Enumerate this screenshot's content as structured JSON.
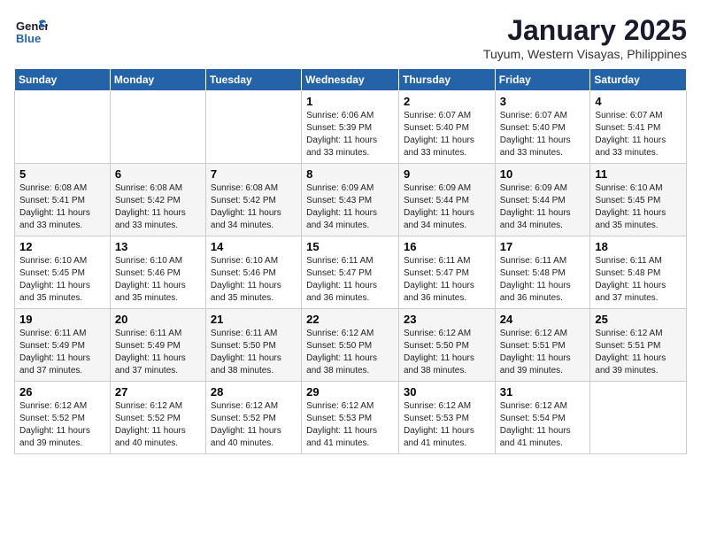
{
  "logo": {
    "line1": "General",
    "line2": "Blue"
  },
  "header": {
    "month": "January 2025",
    "location": "Tuyum, Western Visayas, Philippines"
  },
  "weekdays": [
    "Sunday",
    "Monday",
    "Tuesday",
    "Wednesday",
    "Thursday",
    "Friday",
    "Saturday"
  ],
  "weeks": [
    [
      {
        "day": "",
        "sunrise": "",
        "sunset": "",
        "daylight": ""
      },
      {
        "day": "",
        "sunrise": "",
        "sunset": "",
        "daylight": ""
      },
      {
        "day": "",
        "sunrise": "",
        "sunset": "",
        "daylight": ""
      },
      {
        "day": "1",
        "sunrise": "Sunrise: 6:06 AM",
        "sunset": "Sunset: 5:39 PM",
        "daylight": "Daylight: 11 hours and 33 minutes."
      },
      {
        "day": "2",
        "sunrise": "Sunrise: 6:07 AM",
        "sunset": "Sunset: 5:40 PM",
        "daylight": "Daylight: 11 hours and 33 minutes."
      },
      {
        "day": "3",
        "sunrise": "Sunrise: 6:07 AM",
        "sunset": "Sunset: 5:40 PM",
        "daylight": "Daylight: 11 hours and 33 minutes."
      },
      {
        "day": "4",
        "sunrise": "Sunrise: 6:07 AM",
        "sunset": "Sunset: 5:41 PM",
        "daylight": "Daylight: 11 hours and 33 minutes."
      }
    ],
    [
      {
        "day": "5",
        "sunrise": "Sunrise: 6:08 AM",
        "sunset": "Sunset: 5:41 PM",
        "daylight": "Daylight: 11 hours and 33 minutes."
      },
      {
        "day": "6",
        "sunrise": "Sunrise: 6:08 AM",
        "sunset": "Sunset: 5:42 PM",
        "daylight": "Daylight: 11 hours and 33 minutes."
      },
      {
        "day": "7",
        "sunrise": "Sunrise: 6:08 AM",
        "sunset": "Sunset: 5:42 PM",
        "daylight": "Daylight: 11 hours and 34 minutes."
      },
      {
        "day": "8",
        "sunrise": "Sunrise: 6:09 AM",
        "sunset": "Sunset: 5:43 PM",
        "daylight": "Daylight: 11 hours and 34 minutes."
      },
      {
        "day": "9",
        "sunrise": "Sunrise: 6:09 AM",
        "sunset": "Sunset: 5:44 PM",
        "daylight": "Daylight: 11 hours and 34 minutes."
      },
      {
        "day": "10",
        "sunrise": "Sunrise: 6:09 AM",
        "sunset": "Sunset: 5:44 PM",
        "daylight": "Daylight: 11 hours and 34 minutes."
      },
      {
        "day": "11",
        "sunrise": "Sunrise: 6:10 AM",
        "sunset": "Sunset: 5:45 PM",
        "daylight": "Daylight: 11 hours and 35 minutes."
      }
    ],
    [
      {
        "day": "12",
        "sunrise": "Sunrise: 6:10 AM",
        "sunset": "Sunset: 5:45 PM",
        "daylight": "Daylight: 11 hours and 35 minutes."
      },
      {
        "day": "13",
        "sunrise": "Sunrise: 6:10 AM",
        "sunset": "Sunset: 5:46 PM",
        "daylight": "Daylight: 11 hours and 35 minutes."
      },
      {
        "day": "14",
        "sunrise": "Sunrise: 6:10 AM",
        "sunset": "Sunset: 5:46 PM",
        "daylight": "Daylight: 11 hours and 35 minutes."
      },
      {
        "day": "15",
        "sunrise": "Sunrise: 6:11 AM",
        "sunset": "Sunset: 5:47 PM",
        "daylight": "Daylight: 11 hours and 36 minutes."
      },
      {
        "day": "16",
        "sunrise": "Sunrise: 6:11 AM",
        "sunset": "Sunset: 5:47 PM",
        "daylight": "Daylight: 11 hours and 36 minutes."
      },
      {
        "day": "17",
        "sunrise": "Sunrise: 6:11 AM",
        "sunset": "Sunset: 5:48 PM",
        "daylight": "Daylight: 11 hours and 36 minutes."
      },
      {
        "day": "18",
        "sunrise": "Sunrise: 6:11 AM",
        "sunset": "Sunset: 5:48 PM",
        "daylight": "Daylight: 11 hours and 37 minutes."
      }
    ],
    [
      {
        "day": "19",
        "sunrise": "Sunrise: 6:11 AM",
        "sunset": "Sunset: 5:49 PM",
        "daylight": "Daylight: 11 hours and 37 minutes."
      },
      {
        "day": "20",
        "sunrise": "Sunrise: 6:11 AM",
        "sunset": "Sunset: 5:49 PM",
        "daylight": "Daylight: 11 hours and 37 minutes."
      },
      {
        "day": "21",
        "sunrise": "Sunrise: 6:11 AM",
        "sunset": "Sunset: 5:50 PM",
        "daylight": "Daylight: 11 hours and 38 minutes."
      },
      {
        "day": "22",
        "sunrise": "Sunrise: 6:12 AM",
        "sunset": "Sunset: 5:50 PM",
        "daylight": "Daylight: 11 hours and 38 minutes."
      },
      {
        "day": "23",
        "sunrise": "Sunrise: 6:12 AM",
        "sunset": "Sunset: 5:50 PM",
        "daylight": "Daylight: 11 hours and 38 minutes."
      },
      {
        "day": "24",
        "sunrise": "Sunrise: 6:12 AM",
        "sunset": "Sunset: 5:51 PM",
        "daylight": "Daylight: 11 hours and 39 minutes."
      },
      {
        "day": "25",
        "sunrise": "Sunrise: 6:12 AM",
        "sunset": "Sunset: 5:51 PM",
        "daylight": "Daylight: 11 hours and 39 minutes."
      }
    ],
    [
      {
        "day": "26",
        "sunrise": "Sunrise: 6:12 AM",
        "sunset": "Sunset: 5:52 PM",
        "daylight": "Daylight: 11 hours and 39 minutes."
      },
      {
        "day": "27",
        "sunrise": "Sunrise: 6:12 AM",
        "sunset": "Sunset: 5:52 PM",
        "daylight": "Daylight: 11 hours and 40 minutes."
      },
      {
        "day": "28",
        "sunrise": "Sunrise: 6:12 AM",
        "sunset": "Sunset: 5:52 PM",
        "daylight": "Daylight: 11 hours and 40 minutes."
      },
      {
        "day": "29",
        "sunrise": "Sunrise: 6:12 AM",
        "sunset": "Sunset: 5:53 PM",
        "daylight": "Daylight: 11 hours and 41 minutes."
      },
      {
        "day": "30",
        "sunrise": "Sunrise: 6:12 AM",
        "sunset": "Sunset: 5:53 PM",
        "daylight": "Daylight: 11 hours and 41 minutes."
      },
      {
        "day": "31",
        "sunrise": "Sunrise: 6:12 AM",
        "sunset": "Sunset: 5:54 PM",
        "daylight": "Daylight: 11 hours and 41 minutes."
      },
      {
        "day": "",
        "sunrise": "",
        "sunset": "",
        "daylight": ""
      }
    ]
  ]
}
